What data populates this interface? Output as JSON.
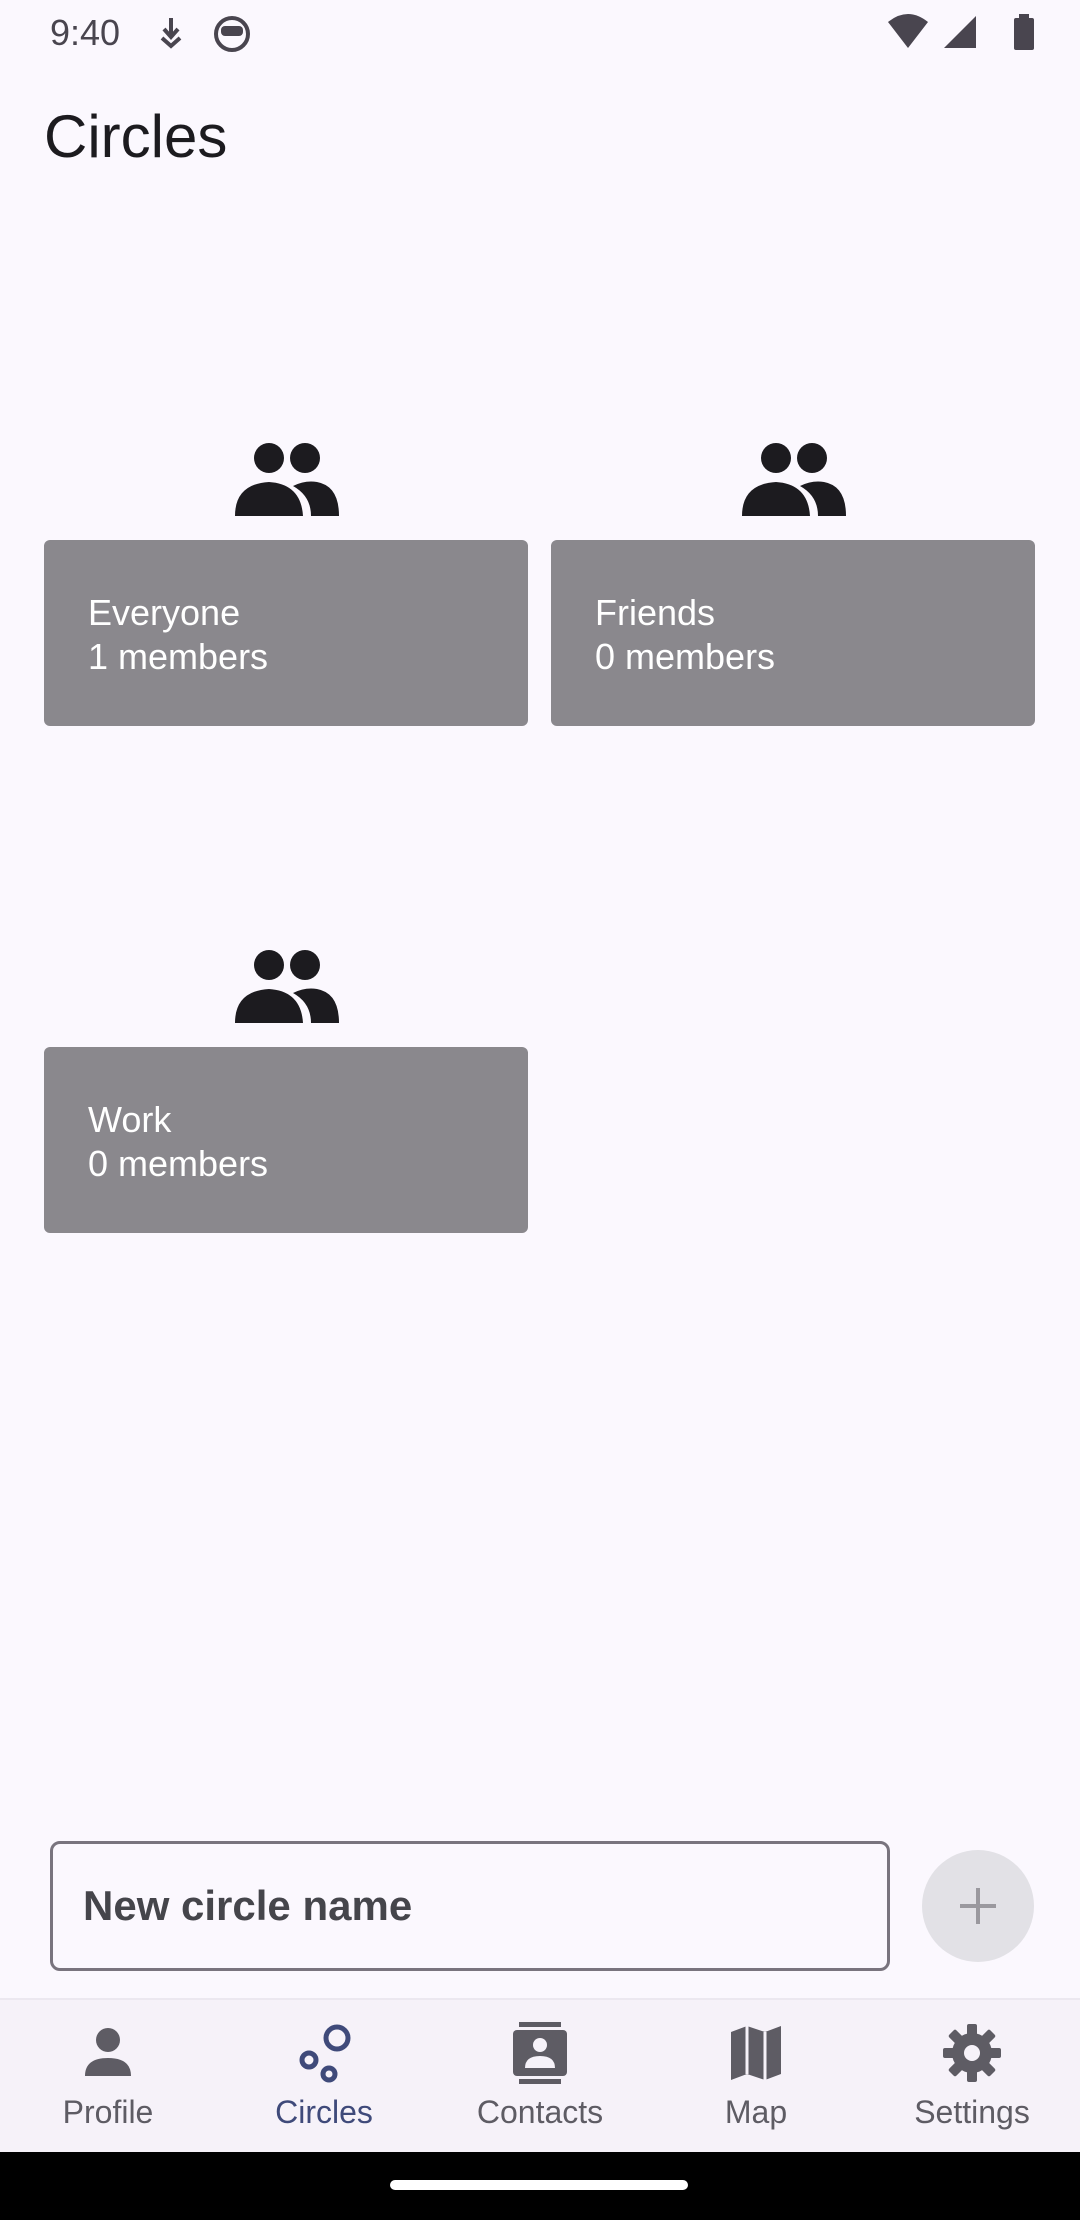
{
  "status_bar": {
    "time": "9:40"
  },
  "page": {
    "title": "Circles"
  },
  "circles": [
    {
      "name": "Everyone",
      "members": "1 members",
      "icon": "group-icon"
    },
    {
      "name": "Friends",
      "members": "0 members",
      "icon": "group-icon"
    },
    {
      "name": "Work",
      "members": "0 members",
      "icon": "group-icon"
    }
  ],
  "new_circle": {
    "placeholder": "New circle name",
    "value": "",
    "add_icon": "plus-icon"
  },
  "bottom_nav": {
    "active": "Circles",
    "items": [
      {
        "label": "Profile",
        "icon": "person-icon"
      },
      {
        "label": "Circles",
        "icon": "bubbles-icon"
      },
      {
        "label": "Contacts",
        "icon": "contact-card-icon"
      },
      {
        "label": "Map",
        "icon": "map-icon"
      },
      {
        "label": "Settings",
        "icon": "gear-icon"
      }
    ]
  },
  "colors": {
    "background": "#fbf8fe",
    "card": "#8a888d",
    "active_nav": "#3f4a7a",
    "nav_background": "#f6f2f9"
  }
}
